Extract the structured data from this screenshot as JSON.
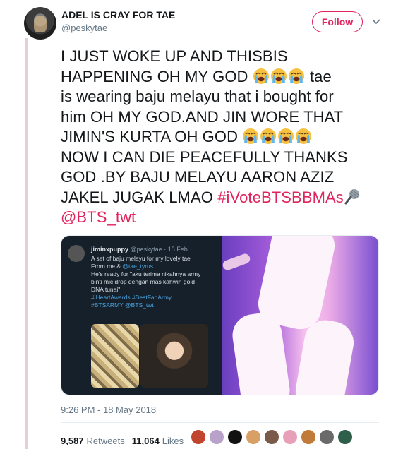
{
  "user": {
    "display_name": "ADEL IS CRAY FOR TAE",
    "handle": "@peskytae",
    "follow_label": "Follow"
  },
  "tweet": {
    "line1": "I JUST WOKE UP AND THISBIS",
    "line2a": "HAPPENING OH MY GOD ",
    "line2b": " tae",
    "line3": "is wearing baju melayu that i bought for",
    "line4": "him OH MY GOD.AND JIN WORE THAT",
    "line5a": "JIMIN'S KURTA OH GOD ",
    "line6": "NOW I CAN DIE PEACEFULLY THANKS",
    "line7": "GOD .BY BAJU MELAYU AARON AZIZ",
    "line8a": "JAKEL JUGAK LMAO ",
    "hashtag": "#iVoteBTSBBMAs",
    "mention": "@BTS_twt"
  },
  "embedded_screenshot": {
    "name": "jiminxpuppy",
    "meta": "@peskytae · 15 Feb",
    "line1": "A set of baju melayu for my lovely tae",
    "line2a": "From me & ",
    "line2b": "@tae_tyrus",
    "line3": "He's ready for \"aku terima nikahnya army",
    "line4": "binti mic drop dengan mas kahwin gold",
    "line5": "DNA tunai\"",
    "tags1": "#iHeartAwards #BestFanArmy",
    "tags2": "#BTSARMY @BTS_twt"
  },
  "timestamp": "9:26 PM - 18 May 2018",
  "stats": {
    "retweets_count": "9,587",
    "retweets_label": "Retweets",
    "likes_count": "11,064",
    "likes_label": "Likes"
  },
  "colors": {
    "accent": "#e0245e",
    "thread_line": "#e6cfd4",
    "secondary_text": "#657786"
  },
  "icons": {
    "crying_emoji": "loudly-crying-face",
    "mic_emoji": "microphone",
    "caret": "chevron-down"
  }
}
